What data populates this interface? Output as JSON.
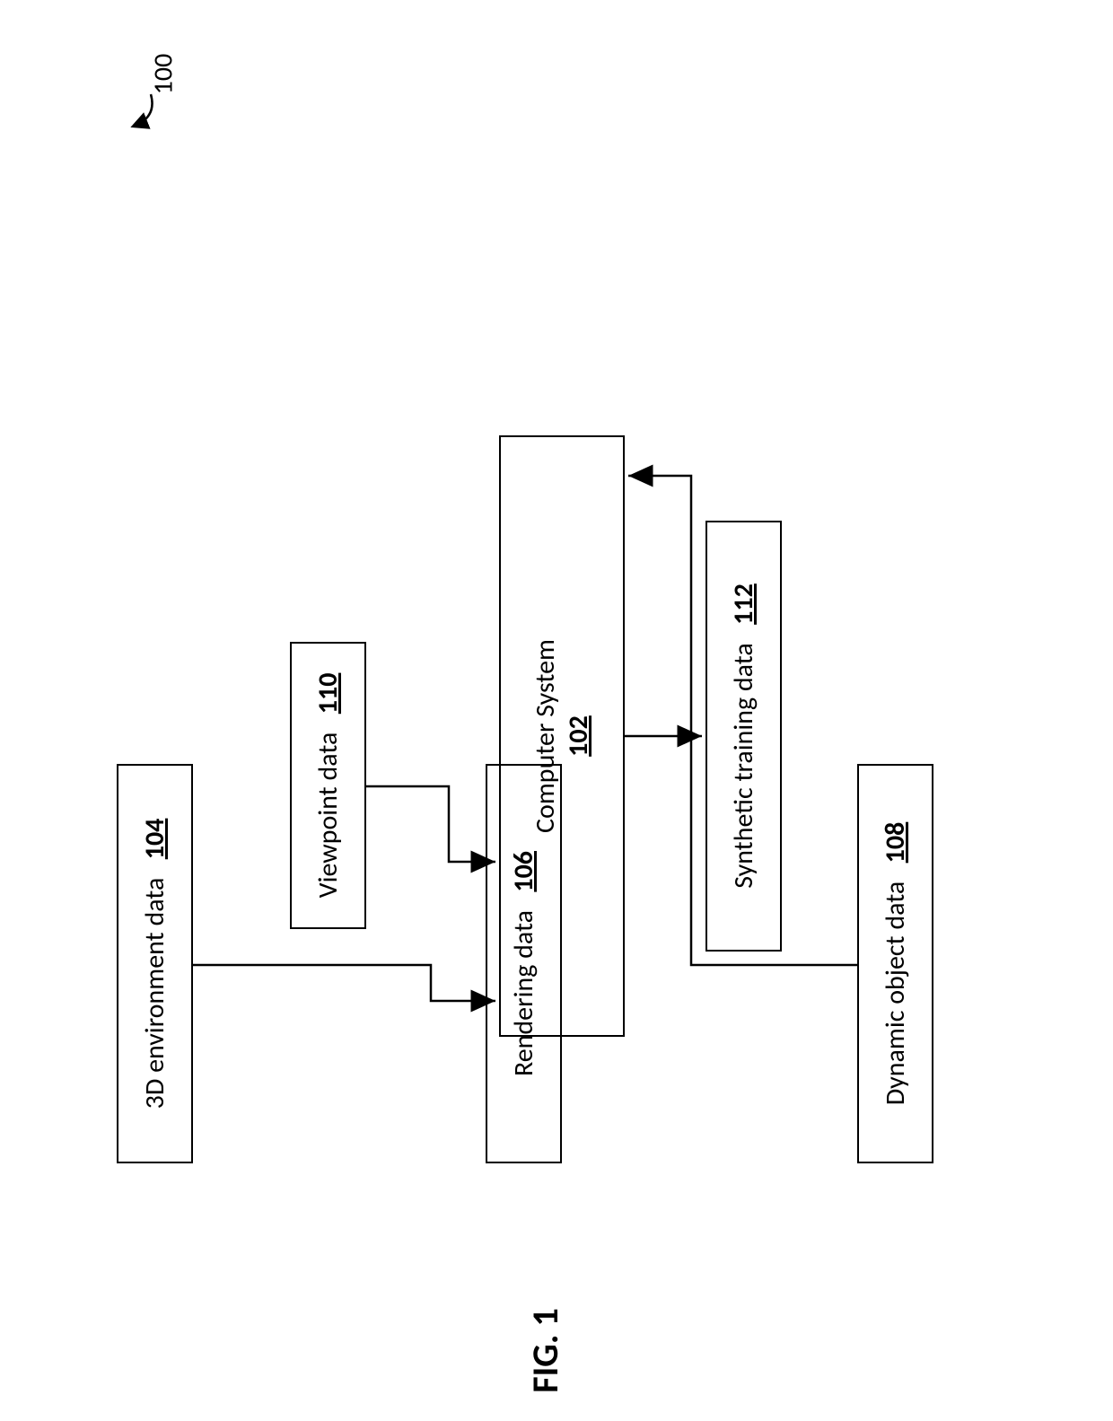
{
  "figure": {
    "caption": "FIG. 1",
    "system_ref": "100"
  },
  "blocks": {
    "env": {
      "label": "3D environment data",
      "ref": "104"
    },
    "render": {
      "label": "Rendering data",
      "ref": "106"
    },
    "dynamic": {
      "label": "Dynamic object data",
      "ref": "108"
    },
    "viewpoint": {
      "label": "Viewpoint data",
      "ref": "110"
    },
    "computer": {
      "label": "Computer System",
      "ref": "102"
    },
    "output": {
      "label": "Synthetic training data",
      "ref": "112"
    }
  }
}
